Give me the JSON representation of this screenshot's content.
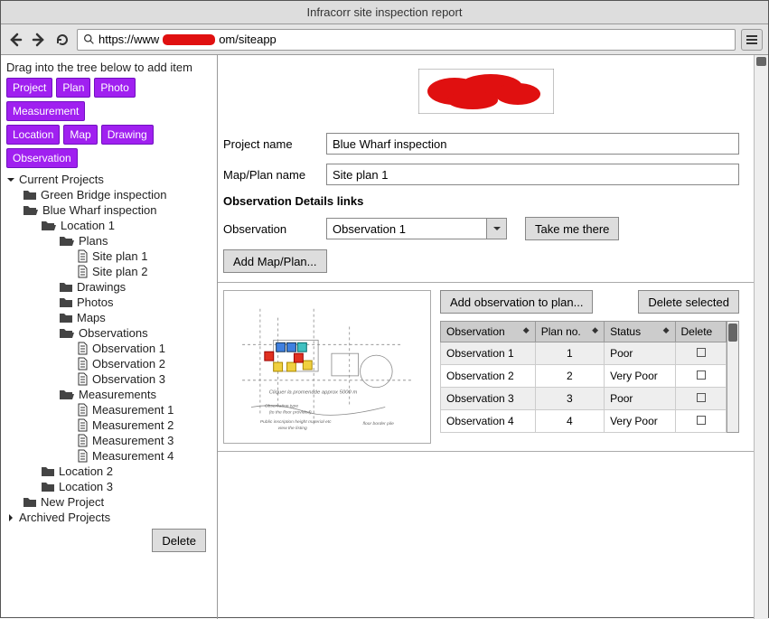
{
  "window": {
    "title": "Infracorr site inspection report"
  },
  "url": {
    "prefix": "https://www",
    "suffix": "om/siteapp"
  },
  "sidebar": {
    "hint": "Drag into the tree below to add item",
    "tags": [
      "Project",
      "Plan",
      "Photo",
      "Measurement",
      "Location",
      "Map",
      "Drawing",
      "Observation"
    ],
    "delete_button": "Delete"
  },
  "tree": {
    "current_projects": "Current Projects",
    "archived_projects": "Archived Projects",
    "green_bridge": "Green Bridge inspection",
    "blue_wharf": "Blue Wharf inspection",
    "location1": "Location 1",
    "plans": "Plans",
    "site_plan_1": "Site plan 1",
    "site_plan_2": "Site plan 2",
    "drawings": "Drawings",
    "photos": "Photos",
    "maps": "Maps",
    "observations": "Observations",
    "obs1": "Observation 1",
    "obs2": "Observation 2",
    "obs3": "Observation 3",
    "measurements": "Measurements",
    "m1": "Measurement 1",
    "m2": "Measurement 2",
    "m3": "Measurement 3",
    "m4": "Measurement 4",
    "location2": "Location 2",
    "location3": "Location 3",
    "new_project": "New Project"
  },
  "form": {
    "project_name_label": "Project name",
    "project_name_value": "Blue Wharf inspection",
    "map_plan_label": "Map/Plan name",
    "map_plan_value": "Site plan 1",
    "obs_section": "Observation Details links",
    "observation_label": "Observation",
    "observation_selected": "Observation 1",
    "take_me_there": "Take me there",
    "add_map_plan": "Add Map/Plan..."
  },
  "obs_panel": {
    "add_button": "Add observation to plan...",
    "delete_button": "Delete selected",
    "columns": {
      "observation": "Observation",
      "plan_no": "Plan no.",
      "status": "Status",
      "delete": "Delete"
    },
    "rows": [
      {
        "observation": "Observation 1",
        "plan_no": "1",
        "status": "Poor"
      },
      {
        "observation": "Observation 2",
        "plan_no": "2",
        "status": "Very Poor"
      },
      {
        "observation": "Observation 3",
        "plan_no": "3",
        "status": "Poor"
      },
      {
        "observation": "Observation 4",
        "plan_no": "4",
        "status": "Very Poor"
      }
    ]
  }
}
